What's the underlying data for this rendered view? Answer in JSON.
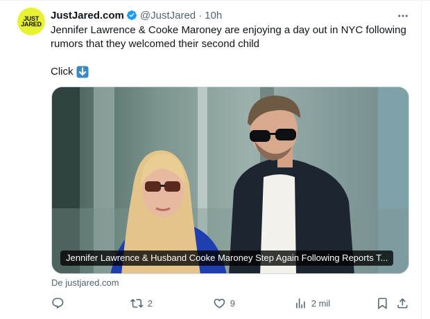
{
  "tweet": {
    "avatar_text_line1": "JUST",
    "avatar_text_line2": "JARED",
    "display_name": "JustJared.com",
    "handle": "@JustJared",
    "separator": "·",
    "time": "10h",
    "text": "Jennifer Lawrence & Cooke Maroney are enjoying a day out in NYC following rumors that they welcomed their second child",
    "click_text": "Click",
    "click_emoji_icon": "down-arrow-emoji-icon",
    "media": {
      "caption": "Jennifer Lawrence & Husband Cooke Maroney Step Again Following Reports T...",
      "source": "De justjared.com"
    },
    "actions": {
      "reply_count": "",
      "retweet_count": "2",
      "like_count": "9",
      "views_count": "2 mil"
    }
  },
  "colors": {
    "avatar_bg": "#e6f233",
    "verified_blue": "#1d9bf0",
    "muted_text": "#536471"
  }
}
